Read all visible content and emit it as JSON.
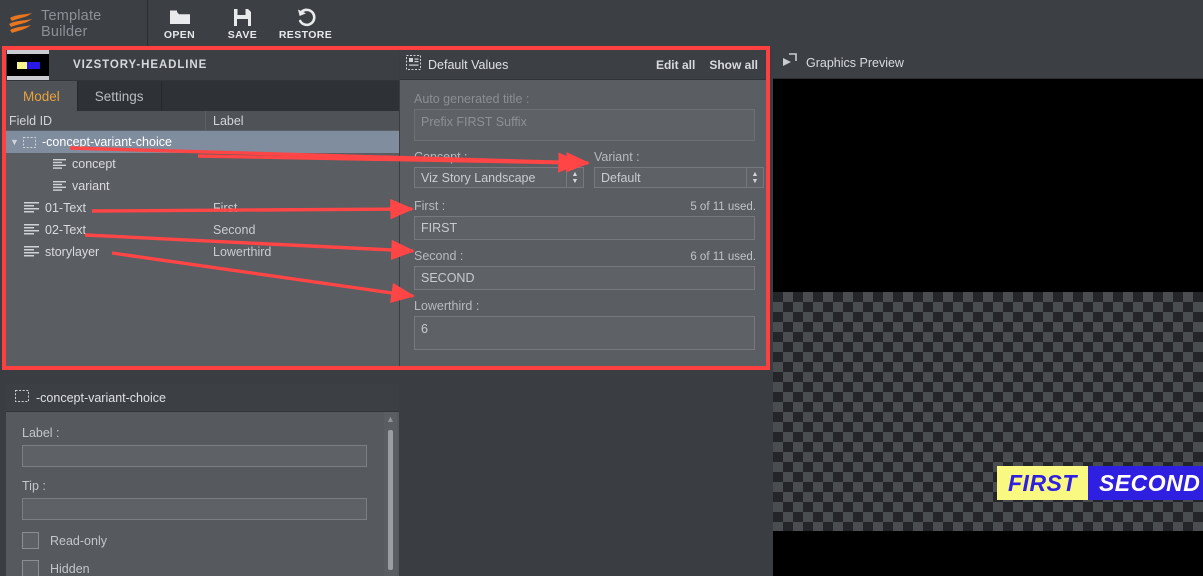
{
  "toolbar": {
    "brand": "Template Builder",
    "buttons": [
      {
        "label": "OPEN",
        "icon": "folder-icon"
      },
      {
        "label": "SAVE",
        "icon": "floppy-disk-icon"
      },
      {
        "label": "RESTORE",
        "icon": "undo-arrow-icon"
      }
    ]
  },
  "left_panel": {
    "title": "VIZSTORY-HEADLINE",
    "tabs": [
      {
        "label": "Model",
        "active": true
      },
      {
        "label": "Settings",
        "active": false
      }
    ],
    "columns": {
      "field_id": "Field ID",
      "label": "Label"
    },
    "rows": [
      {
        "field_id": "-concept-variant-choice",
        "label": "",
        "indent": 0,
        "selected": true,
        "expandable": true,
        "icon": "group-box-icon"
      },
      {
        "field_id": "concept",
        "label": "",
        "indent": 2,
        "selected": false,
        "expandable": false,
        "icon": "text-lines-icon"
      },
      {
        "field_id": "variant",
        "label": "",
        "indent": 2,
        "selected": false,
        "expandable": false,
        "icon": "text-lines-icon"
      },
      {
        "field_id": "01-Text",
        "label": "First",
        "indent": 1,
        "selected": false,
        "expandable": false,
        "icon": "text-lines-icon"
      },
      {
        "field_id": "02-Text",
        "label": "Second",
        "indent": 1,
        "selected": false,
        "expandable": false,
        "icon": "text-lines-icon"
      },
      {
        "field_id": "storylayer",
        "label": "Lowerthird",
        "indent": 1,
        "selected": false,
        "expandable": false,
        "icon": "text-lines-icon"
      }
    ]
  },
  "properties_panel": {
    "title": "-concept-variant-choice",
    "label_field": {
      "label": "Label :",
      "value": ""
    },
    "tip_field": {
      "label": "Tip :",
      "value": ""
    },
    "checkboxes": [
      {
        "label": "Read-only",
        "checked": false
      },
      {
        "label": "Hidden",
        "checked": false
      }
    ]
  },
  "default_values": {
    "title": "Default Values",
    "edit_all": "Edit all",
    "show_all": "Show all",
    "auto_title": {
      "label": "Auto generated title :",
      "value": "Prefix FIRST Suffix"
    },
    "concept": {
      "label": "Concept :",
      "value": "Viz Story Landscape"
    },
    "variant": {
      "label": "Variant :",
      "value": "Default"
    },
    "first": {
      "label": "First :",
      "value": "FIRST",
      "used": "5 of 11 used."
    },
    "second": {
      "label": "Second :",
      "value": "SECOND",
      "used": "6 of 11 used."
    },
    "lowerthird": {
      "label": "Lowerthird :",
      "value": "6",
      "used": ""
    }
  },
  "preview": {
    "title": "Graphics Preview",
    "icon": "preview-play-icon",
    "graphic": {
      "first_text": "FIRST",
      "second_text": "SECOND",
      "first_bg": "#f9f881",
      "first_fg": "#2f1fe0",
      "second_bg": "#2f1fe0",
      "second_fg": "#ffffff"
    }
  },
  "annotation": {
    "highlight_color": "#ff4040",
    "arrow_color": "#ff4545"
  }
}
